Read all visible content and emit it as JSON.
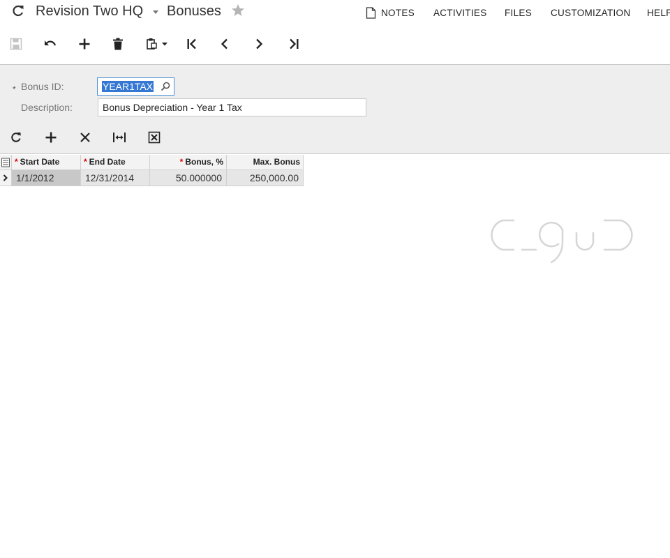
{
  "header": {
    "company": "Revision Two HQ",
    "screen_title": "Bonuses",
    "nav": {
      "notes": "NOTES",
      "activities": "ACTIVITIES",
      "files": "FILES",
      "customization": "CUSTOMIZATION",
      "help": "HELP"
    }
  },
  "toolbar": {
    "icons": [
      "save-icon",
      "undo-icon",
      "add-icon",
      "delete-icon",
      "clipboard-icon",
      "first-icon",
      "previous-icon",
      "next-icon",
      "last-icon"
    ]
  },
  "form": {
    "bonus_id_label": "Bonus ID:",
    "bonus_id_value": "YEAR1TAX",
    "description_label": "Description:",
    "description_value": "Bonus Depreciation - Year 1 Tax"
  },
  "grid": {
    "columns": {
      "start_date": "Start Date",
      "end_date": "End Date",
      "bonus_pct": "Bonus, %",
      "max_bonus": "Max. Bonus"
    },
    "rows": [
      {
        "start_date": "1/1/2012",
        "end_date": "12/31/2014",
        "bonus_pct": "50.000000",
        "max_bonus": "250,000.00"
      }
    ]
  },
  "colors": {
    "accent": "#3478d4",
    "required": "#dd0000",
    "panel": "#eeeeee"
  }
}
